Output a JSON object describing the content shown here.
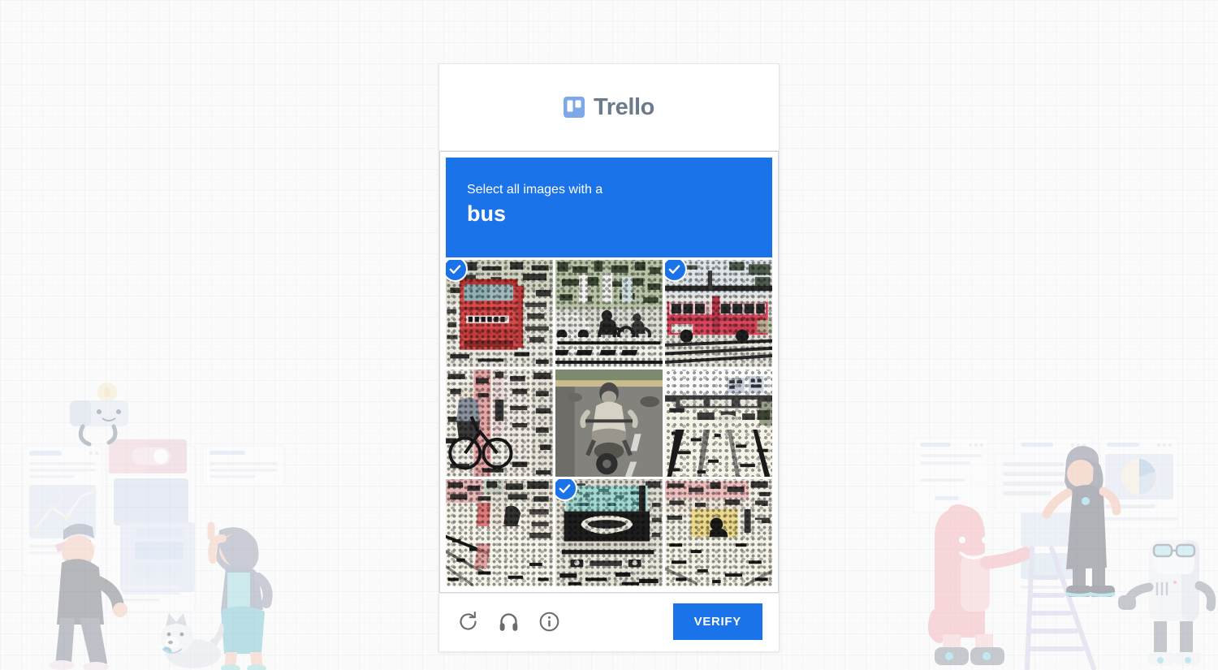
{
  "brand": {
    "name": "Trello",
    "logo_icon": "trello-logo-icon",
    "logo_color": "#7fa8e8",
    "text_color": "#6b7b8c"
  },
  "captcha": {
    "prompt_intro": "Select all images with a",
    "prompt_target": "bus",
    "banner_color": "#1a73e8",
    "grid": {
      "columns": 3,
      "rows": 3,
      "cells": [
        {
          "position": 1,
          "label": "red bus front view on street",
          "selected": true,
          "scene": "bus-red-front"
        },
        {
          "position": 2,
          "label": "street scene with cars and crosswalk",
          "selected": false,
          "scene": "street-cars"
        },
        {
          "position": 3,
          "label": "red articulated city bus",
          "selected": true,
          "scene": "bus-red-side"
        },
        {
          "position": 4,
          "label": "cyclist beside building",
          "selected": false,
          "scene": "cyclist"
        },
        {
          "position": 5,
          "label": "motorcycle rider on road",
          "selected": false,
          "scene": "motorcycle"
        },
        {
          "position": 6,
          "label": "highway with overpass signs",
          "selected": false,
          "scene": "highway"
        },
        {
          "position": 7,
          "label": "bicycle on roadside",
          "selected": false,
          "scene": "bicycle-road"
        },
        {
          "position": 8,
          "label": "bus front with windshield",
          "selected": true,
          "scene": "bus-front-dark"
        },
        {
          "position": 9,
          "label": "person on scooter in street",
          "selected": false,
          "scene": "scooter-street"
        }
      ]
    },
    "footer": {
      "refresh_icon": "refresh-icon",
      "audio_icon": "headphones-icon",
      "info_icon": "info-icon",
      "verify_label": "VERIFY",
      "verify_color": "#1a73e8"
    }
  },
  "background": {
    "page_color": "#fbfbfb",
    "left_illustration": "team-collaboration-illustration",
    "right_illustration": "team-ladder-robot-illustration"
  }
}
